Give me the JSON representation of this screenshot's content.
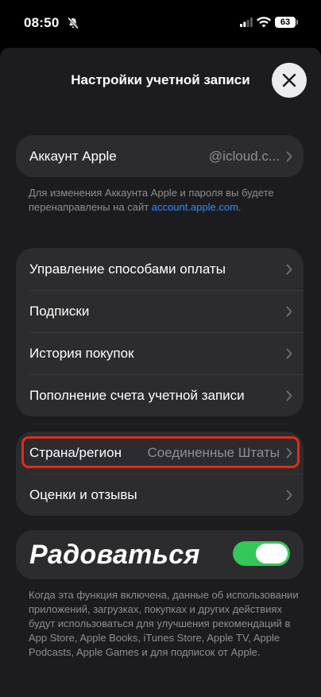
{
  "status_bar": {
    "time": "08:50",
    "battery": "63"
  },
  "sheet": {
    "title": "Настройки учетной записи"
  },
  "apple_account": {
    "label": "Аккаунт Apple",
    "value": "@icloud.c..."
  },
  "apple_account_note": {
    "text": "Для изменения Аккаунта Apple и пароля вы будете перенаправлены на сайт ",
    "link": "account.apple.com",
    "suffix": "."
  },
  "payments_group": [
    {
      "label": "Управление способами оплаты"
    },
    {
      "label": "Подписки"
    },
    {
      "label": "История покупок"
    },
    {
      "label": "Пополнение счета учетной записи"
    }
  ],
  "region_group": {
    "country_label": "Страна/регион",
    "country_value": "Соединенные Штаты",
    "ratings_label": "Оценки и отзывы"
  },
  "personalization": {
    "label": "Радоваться",
    "enabled": true,
    "note": "Когда эта функция включена, данные об использовании приложений, загрузках, покупках и других действиях будут использоваться для улучшения рекомендаций в App Store, Apple Books, iTunes Store, Apple TV, Apple Podcasts, Apple Games и для подписок от Apple."
  },
  "colors": {
    "accent_link": "#2f8cff",
    "toggle_on": "#34c759",
    "highlight": "#e32b16"
  },
  "icons": [
    "mute-icon",
    "signal-icon",
    "wifi-icon",
    "close-icon",
    "chevron-right-icon"
  ]
}
